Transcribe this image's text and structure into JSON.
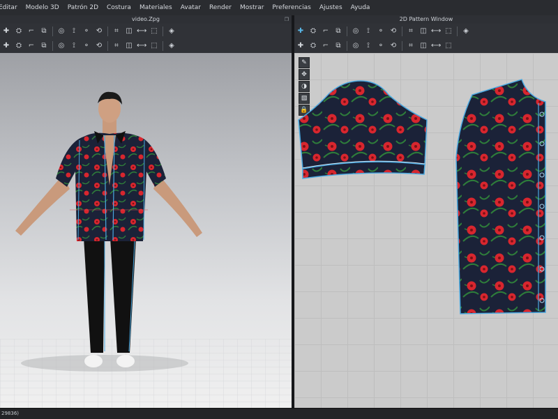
{
  "menu": [
    "Editar",
    "Modelo 3D",
    "Patrón 2D",
    "Costura",
    "Materiales",
    "Avatar",
    "Render",
    "Mostrar",
    "Preferencias",
    "Ajustes",
    "Ayuda"
  ],
  "windows": {
    "left_title": "video.Zpg",
    "right_title": "2D Pattern Window"
  },
  "status": {
    "text": "29836)"
  },
  "colors": {
    "fabric_dark": "#1b2238",
    "flower": "#d8262e",
    "leaf": "#2e7d3a",
    "seam": "#4aa8df",
    "pants": "#111111"
  },
  "icons": {
    "toolbar3d_row1": [
      "move-icon",
      "rotate-icon",
      "select-icon",
      "pin-icon",
      "fold-icon",
      "tack-icon",
      "wand-icon",
      "stamp-icon",
      "shirt-icon",
      "avatar-icon",
      "measure-icon",
      "hook-icon",
      "camera-icon"
    ],
    "toolbar3d_row2": [
      "arrange-icon",
      "seam-icon",
      "select-mesh-icon",
      "layer-icon",
      "texture-icon",
      "fit-icon",
      "pin-point-icon",
      "globe-icon",
      "tag-icon",
      "pattern-icon",
      "grid-icon",
      "button-icon",
      "link-icon"
    ],
    "toolbar2d_row1": [
      "edit-pattern-icon",
      "transform-icon",
      "segment-icon",
      "rectangle-icon",
      "polygon-icon",
      "ellipse-icon",
      "cut-icon",
      "line-icon",
      "curve-icon",
      "sew-icon",
      "text-icon",
      "font-icon",
      "ruler-icon"
    ],
    "toolbar2d_row2": [
      "internal-line-icon",
      "dart-icon",
      "pleat-icon",
      "notch-icon",
      "grade-icon",
      "symmetric-icon",
      "seam-allowance-icon",
      "fold-line-icon",
      "trace-icon",
      "zip-icon",
      "grain-icon",
      "pattern-list-icon"
    ],
    "tools2d": [
      "brush-icon",
      "move-tool-icon",
      "color-picker-icon",
      "fill-icon",
      "lock-icon"
    ]
  }
}
